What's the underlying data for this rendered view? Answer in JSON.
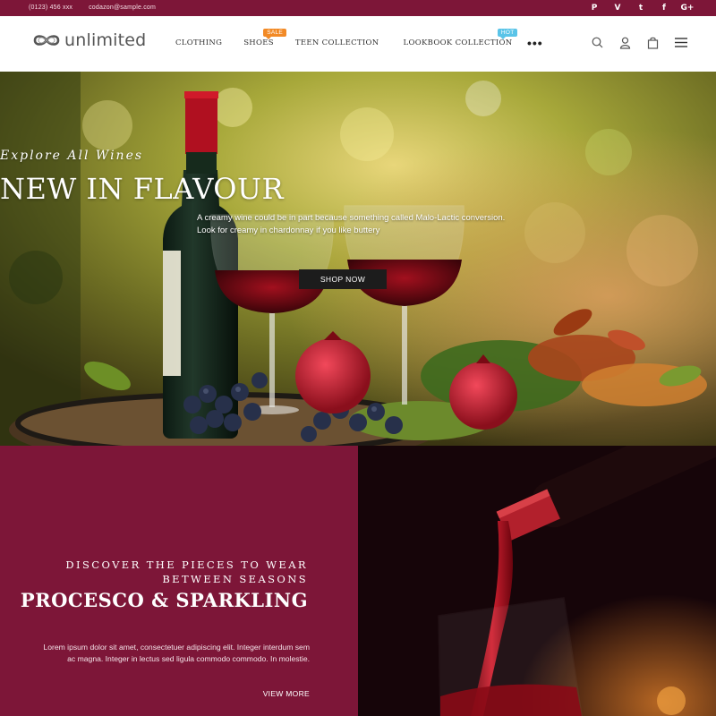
{
  "topbar": {
    "phone": "(0123) 456 xxx",
    "email": "codazon@sample.com",
    "socials": [
      {
        "icon": "pinterest-icon",
        "glyph": "P"
      },
      {
        "icon": "vimeo-icon",
        "glyph": "V"
      },
      {
        "icon": "twitter-icon",
        "glyph": "t"
      },
      {
        "icon": "facebook-icon",
        "glyph": "f"
      },
      {
        "icon": "google-plus-icon",
        "glyph": "G+"
      }
    ]
  },
  "header": {
    "logo_text": "unlimited",
    "nav": [
      {
        "label": "CLOTHING",
        "badge": null
      },
      {
        "label": "SHOES",
        "badge": "sale"
      },
      {
        "label": "TEEN COLLECTION",
        "badge": null
      },
      {
        "label": "LOOKBOOK COLLECTION",
        "badge": "hot"
      }
    ],
    "more": "•••",
    "icons": [
      "search-icon",
      "account-icon",
      "cart-icon",
      "menu-icon"
    ]
  },
  "hero": {
    "kicker": "Explore All Wines",
    "title": "NEW IN FLAVOUR",
    "description": "A creamy wine could be in part because something called Malo-Lactic conversion. Look for creamy in chardonnay if you like buttery",
    "button": "SHOP NOW"
  },
  "promo": {
    "kicker_line1": "DISCOVER THE PIECES TO WEAR",
    "kicker_line2": "BETWEEN SEASONS",
    "title": "PROCESCO & SPARKLING",
    "description": "Lorem ipsum dolor sit amet, consectetuer adipiscing elit. Integer interdum sem ac magna. Integer in lectus sed ligula commodo commodo. In molestie.",
    "link": "VIEW MORE"
  },
  "colors": {
    "brand": "#7d1638",
    "sale_badge": "#f28a26",
    "hot_badge": "#5ac4e8",
    "button": "#1c1c1c"
  }
}
